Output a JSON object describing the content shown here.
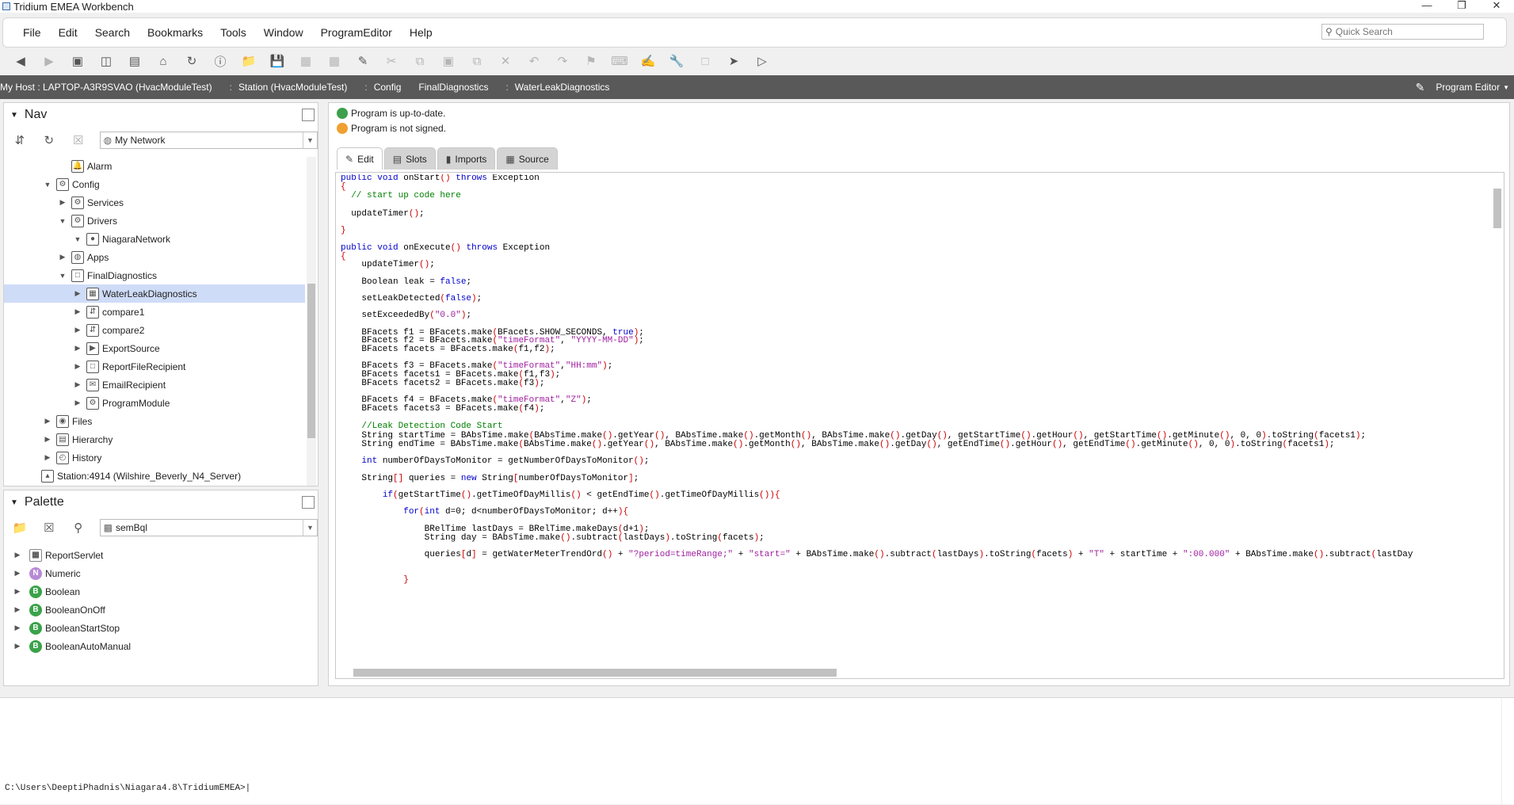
{
  "window": {
    "title": "Tridium EMEA Workbench",
    "controls": [
      "—",
      "❐",
      "✕"
    ]
  },
  "menu": {
    "items": [
      "File",
      "Edit",
      "Search",
      "Bookmarks",
      "Tools",
      "Window",
      "ProgramEditor",
      "Help"
    ],
    "quick_search_placeholder": "Quick Search"
  },
  "path": {
    "crumbs": [
      "My Host : LAPTOP-A3R9SVAO (HvacModuleTest)",
      "Station (HvacModuleTest)",
      "Config",
      "FinalDiagnostics",
      "WaterLeakDiagnostics"
    ],
    "view": "Program Editor"
  },
  "nav": {
    "title": "Nav",
    "combo": "My Network",
    "tree": [
      {
        "label": "Alarm",
        "indent": 3,
        "twisty": "",
        "icon": "bell"
      },
      {
        "label": "Config",
        "indent": 2,
        "twisty": "▼",
        "icon": "config"
      },
      {
        "label": "Services",
        "indent": 3,
        "twisty": "▶",
        "icon": "services"
      },
      {
        "label": "Drivers",
        "indent": 3,
        "twisty": "▼",
        "icon": "drivers"
      },
      {
        "label": "NiagaraNetwork",
        "indent": 4,
        "twisty": "▼",
        "icon": "network"
      },
      {
        "label": "Apps",
        "indent": 3,
        "twisty": "▶",
        "icon": "apps"
      },
      {
        "label": "FinalDiagnostics",
        "indent": 3,
        "twisty": "▼",
        "icon": "folder"
      },
      {
        "label": "WaterLeakDiagnostics",
        "indent": 4,
        "twisty": "▶",
        "icon": "program",
        "selected": true
      },
      {
        "label": "compare1",
        "indent": 4,
        "twisty": "▶",
        "icon": "compare"
      },
      {
        "label": "compare2",
        "indent": 4,
        "twisty": "▶",
        "icon": "compare"
      },
      {
        "label": "ExportSource",
        "indent": 4,
        "twisty": "▶",
        "icon": "export"
      },
      {
        "label": "ReportFileRecipient",
        "indent": 4,
        "twisty": "▶",
        "icon": "file"
      },
      {
        "label": "EmailRecipient",
        "indent": 4,
        "twisty": "▶",
        "icon": "email"
      },
      {
        "label": "ProgramModule",
        "indent": 4,
        "twisty": "▶",
        "icon": "module"
      },
      {
        "label": "Files",
        "indent": 2,
        "twisty": "▶",
        "icon": "files"
      },
      {
        "label": "Hierarchy",
        "indent": 2,
        "twisty": "▶",
        "icon": "hierarchy"
      },
      {
        "label": "History",
        "indent": 2,
        "twisty": "▶",
        "icon": "history"
      },
      {
        "label": "Station:4914 (Wilshire_Beverly_N4_Server)",
        "indent": 1,
        "twisty": "",
        "icon": "station"
      }
    ]
  },
  "palette": {
    "title": "Palette",
    "combo": "semBql",
    "items": [
      {
        "label": "ReportServlet",
        "badge": "▦",
        "kind": "r"
      },
      {
        "label": "Numeric",
        "badge": "N",
        "kind": "n"
      },
      {
        "label": "Boolean",
        "badge": "B",
        "kind": "b"
      },
      {
        "label": "BooleanOnOff",
        "badge": "B",
        "kind": "b"
      },
      {
        "label": "BooleanStartStop",
        "badge": "B",
        "kind": "b"
      },
      {
        "label": "BooleanAutoManual",
        "badge": "B",
        "kind": "b"
      }
    ]
  },
  "program": {
    "status_uptodate": "Program is up-to-date.",
    "status_signed": "Program is not signed.",
    "tabs": [
      "Edit",
      "Slots",
      "Imports",
      "Source"
    ],
    "code_lines": [
      "public void onStart() throws Exception",
      "{",
      "  // start up code here",
      "",
      "  updateTimer();",
      "",
      "}",
      "",
      "public void onExecute() throws Exception",
      "{",
      "    updateTimer();",
      "",
      "    Boolean leak = false;",
      "",
      "    setLeakDetected(false);",
      "",
      "    setExceededBy(\"0.0\");",
      "",
      "    BFacets f1 = BFacets.make(BFacets.SHOW_SECONDS, true);",
      "    BFacets f2 = BFacets.make(\"timeFormat\", \"YYYY-MM-DD\");",
      "    BFacets facets = BFacets.make(f1,f2);",
      "",
      "    BFacets f3 = BFacets.make(\"timeFormat\",\"HH:mm\");",
      "    BFacets facets1 = BFacets.make(f1,f3);",
      "    BFacets facets2 = BFacets.make(f3);",
      "",
      "    BFacets f4 = BFacets.make(\"timeFormat\",\"Z\");",
      "    BFacets facets3 = BFacets.make(f4);",
      "",
      "    //Leak Detection Code Start",
      "    String startTime = BAbsTime.make(BAbsTime.make().getYear(), BAbsTime.make().getMonth(), BAbsTime.make().getDay(), getStartTime().getHour(), getStartTime().getMinute(), 0, 0).toString(facets1);",
      "    String endTime = BAbsTime.make(BAbsTime.make().getYear(), BAbsTime.make().getMonth(), BAbsTime.make().getDay(), getEndTime().getHour(), getEndTime().getMinute(), 0, 0).toString(facets1);",
      "",
      "    int numberOfDaysToMonitor = getNumberOfDaysToMonitor();",
      "",
      "    String[] queries = new String[numberOfDaysToMonitor];",
      "",
      "        if(getStartTime().getTimeOfDayMillis() < getEndTime().getTimeOfDayMillis()){",
      "",
      "            for(int d=0; d<numberOfDaysToMonitor; d++){",
      "",
      "                BRelTime lastDays = BRelTime.makeDays(d+1);",
      "                String day = BAbsTime.make().subtract(lastDays).toString(facets);",
      "",
      "                queries[d] = getWaterMeterTrendOrd() + \"?period=timeRange;\" + \"start=\" + BAbsTime.make().subtract(lastDays).toString(facets) + \"T\" + startTime + \":00.000\" + BAbsTime.make().subtract(lastDay",
      "",
      "",
      "            }"
    ]
  },
  "console": {
    "prompt": "C:\\Users\\DeeptiPhadnis\\Niagara4.8\\TridiumEMEA>"
  }
}
